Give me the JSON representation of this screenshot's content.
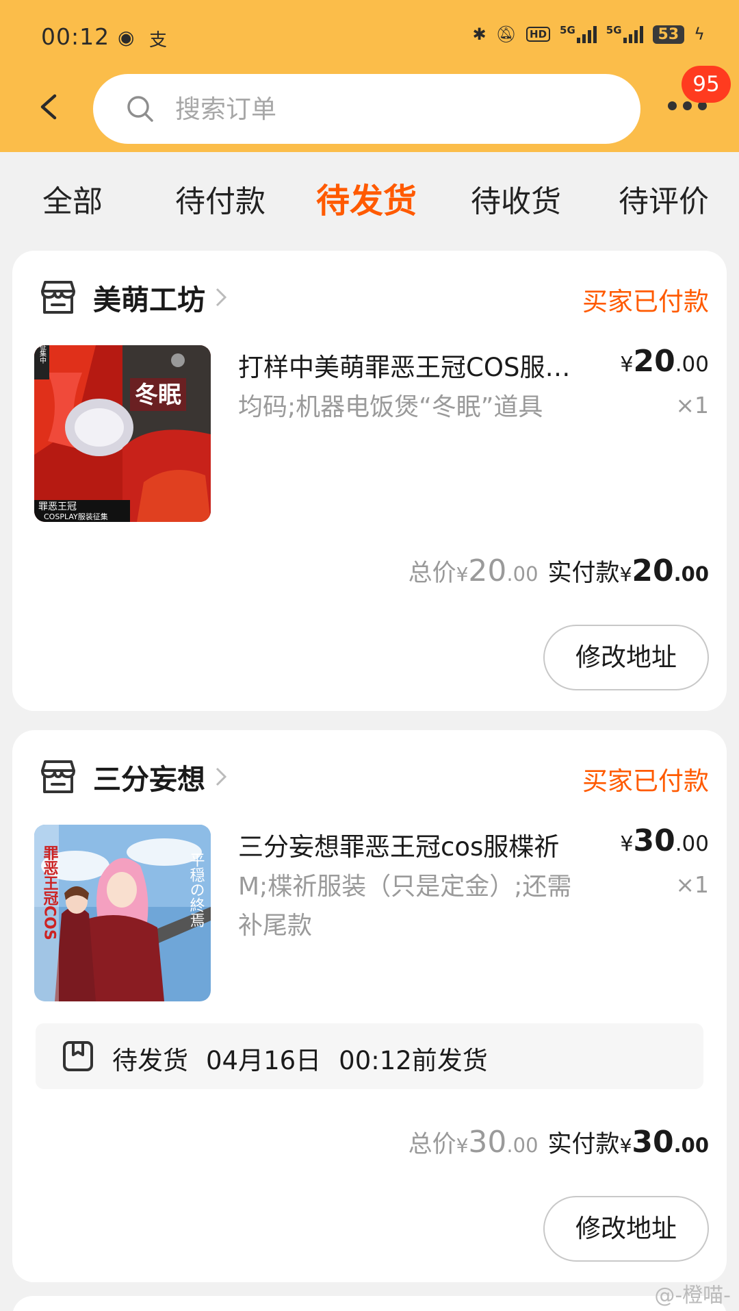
{
  "status_bar": {
    "time": "00:12",
    "network1": "5G",
    "network2": "5G",
    "hd_label": "HD",
    "battery": "53"
  },
  "search": {
    "placeholder": "搜索订单"
  },
  "notification_badge": "95",
  "tabs": [
    {
      "label": "全部",
      "active": false
    },
    {
      "label": "待付款",
      "active": false
    },
    {
      "label": "待发货",
      "active": true
    },
    {
      "label": "待收货",
      "active": false
    },
    {
      "label": "待评价",
      "active": false
    }
  ],
  "orders": [
    {
      "shop_name": "美萌工坊",
      "status": "买家已付款",
      "product_name": "打样中美萌罪恶王冠COS服装征集",
      "spec": "均码;机器电饭煲“冬眠”道具",
      "price_symbol": "¥",
      "price_int": "20",
      "price_dec": ".00",
      "qty": "×1",
      "total_label": "总价",
      "total_int": "20",
      "total_dec": ".00",
      "paid_label": "实付款",
      "paid_int": "20",
      "paid_dec": ".00",
      "button": "修改地址",
      "thumb_text_top": "冬眠",
      "thumb_text_bottom": "罪恶王冠",
      "thumb_text_sub": "COSPLAY服装征集",
      "thumb_badge": "征集中"
    },
    {
      "shop_name": "三分妄想",
      "status": "买家已付款",
      "product_name": "三分妄想罪恶王冠cos服楪祈",
      "spec": "M;楪祈服装（只是定金）;还需补尾款",
      "price_symbol": "¥",
      "price_int": "30",
      "price_dec": ".00",
      "qty": "×1",
      "ship_status": "待发货",
      "ship_date": "04月16日",
      "ship_time": "00:12前发货",
      "total_label": "总价",
      "total_int": "30",
      "total_dec": ".00",
      "paid_label": "实付款",
      "paid_int": "30",
      "paid_dec": ".00",
      "button": "修改地址",
      "thumb_text_left": "罪恶王冠COS",
      "thumb_text_right": "平穏の終焉"
    }
  ],
  "watermark": "@-橙喵-",
  "colors": {
    "header_bg": "#fbbd4a",
    "accent": "#ff5a00",
    "badge": "#ff3b1f"
  }
}
